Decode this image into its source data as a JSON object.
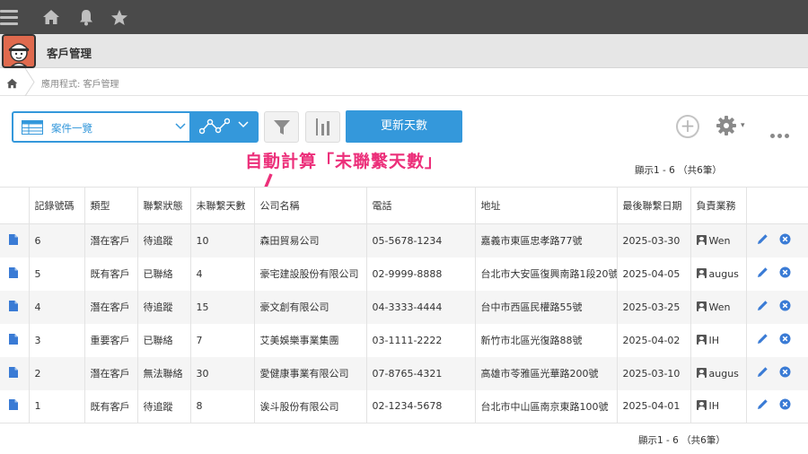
{
  "app": {
    "title": "客戶管理"
  },
  "breadcrumb": {
    "text": "應用程式: 客戶管理"
  },
  "toolbar": {
    "view_label": "案件一覽",
    "update_button": "更新天數"
  },
  "annotation": "自動計算「未聯繫天數」",
  "pager_top": "顯示1 - 6 （共6筆）",
  "pager_bottom": "顯示1 - 6 （共6筆）",
  "colors": {
    "accent": "#3498db",
    "annotation": "#ec2f7a",
    "app_icon": "#e06a4e"
  },
  "icons": [
    "menu-icon",
    "home-icon",
    "bell-icon",
    "star-icon",
    "table-icon",
    "graph-icon",
    "filter-icon",
    "bar-chart-icon",
    "plus-icon",
    "gear-icon",
    "more-icon",
    "record-icon",
    "edit-icon",
    "delete-icon",
    "user-icon"
  ],
  "table": {
    "headers": [
      "記錄號碼",
      "類型",
      "聯繫狀態",
      "未聯繫天數",
      "公司名稱",
      "電話",
      "地址",
      "最後聯繫日期",
      "負責業務"
    ],
    "rows": [
      {
        "id": "6",
        "type": "潛在客戶",
        "status": "待追蹤",
        "days": "10",
        "company": "森田貿易公司",
        "phone": "05-5678-1234",
        "address": "嘉義市東區忠孝路77號",
        "last": "2025-03-30",
        "owner": "Wen"
      },
      {
        "id": "5",
        "type": "既有客戶",
        "status": "已聯絡",
        "days": "4",
        "company": "豪宅建設股份有限公司",
        "phone": "02-9999-8888",
        "address": "台北市大安區復興南路1段20號",
        "last": "2025-04-05",
        "owner": "augus"
      },
      {
        "id": "4",
        "type": "潛在客戶",
        "status": "待追蹤",
        "days": "15",
        "company": "豪文創有限公司",
        "phone": "04-3333-4444",
        "address": "台中市西區民權路55號",
        "last": "2025-03-25",
        "owner": "Wen"
      },
      {
        "id": "3",
        "type": "重要客戶",
        "status": "已聯絡",
        "days": "7",
        "company": "艾美娛樂事業集團",
        "phone": "03-1111-2222",
        "address": "新竹市北區光復路88號",
        "last": "2025-04-02",
        "owner": "IH"
      },
      {
        "id": "2",
        "type": "潛在客戶",
        "status": "無法聯絡",
        "days": "30",
        "company": "愛健康事業有限公司",
        "phone": "07-8765-4321",
        "address": "高雄市苓雅區光華路200號",
        "last": "2025-03-10",
        "owner": "augus"
      },
      {
        "id": "1",
        "type": "既有客戶",
        "status": "待追蹤",
        "days": "8",
        "company": "诶斗股份有限公司",
        "phone": "02-1234-5678",
        "address": "台北市中山區南京東路100號",
        "last": "2025-04-01",
        "owner": "IH"
      }
    ]
  }
}
